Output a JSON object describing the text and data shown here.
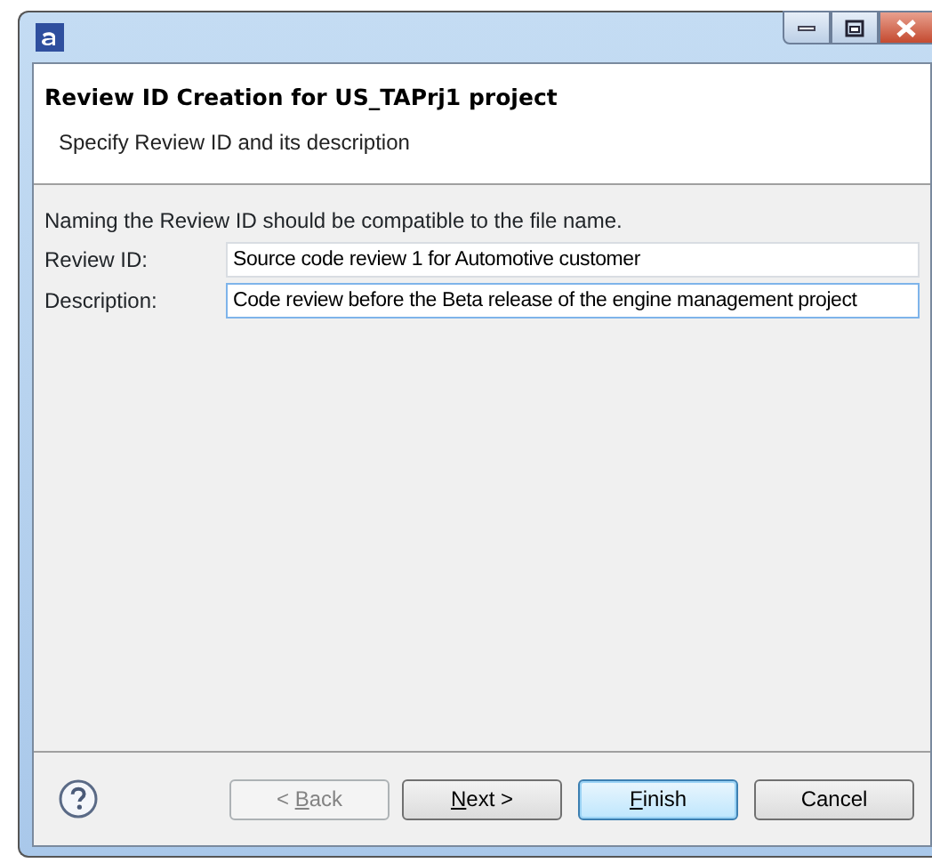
{
  "window": {
    "title_bar": {
      "controls": [
        {
          "kind": "minimize"
        },
        {
          "kind": "maximize"
        },
        {
          "kind": "close"
        }
      ]
    }
  },
  "header": {
    "title": "Review ID Creation for US_TAPrj1 project",
    "subtitle": "Specify Review ID and its description"
  },
  "form": {
    "hint": "Naming the Review ID should be compatible to the file name.",
    "fields": [
      {
        "label": "Review ID:",
        "value": "Source code review 1 for Automotive customer",
        "focused": false
      },
      {
        "label": "Description:",
        "value": "Code review before the Beta release of the engine management project",
        "focused": true
      }
    ]
  },
  "buttons": [
    {
      "label": {
        "before": "< ",
        "mnemonic": "B",
        "after": "ack"
      },
      "disabled": true,
      "default": false
    },
    {
      "label": {
        "mnemonic": "N",
        "after": "ext >"
      },
      "disabled": false,
      "default": false
    },
    {
      "label": {
        "mnemonic": "F",
        "after": "inish"
      },
      "disabled": false,
      "default": true
    },
    {
      "label": {
        "before": "Cancel"
      },
      "disabled": false,
      "default": false
    }
  ]
}
